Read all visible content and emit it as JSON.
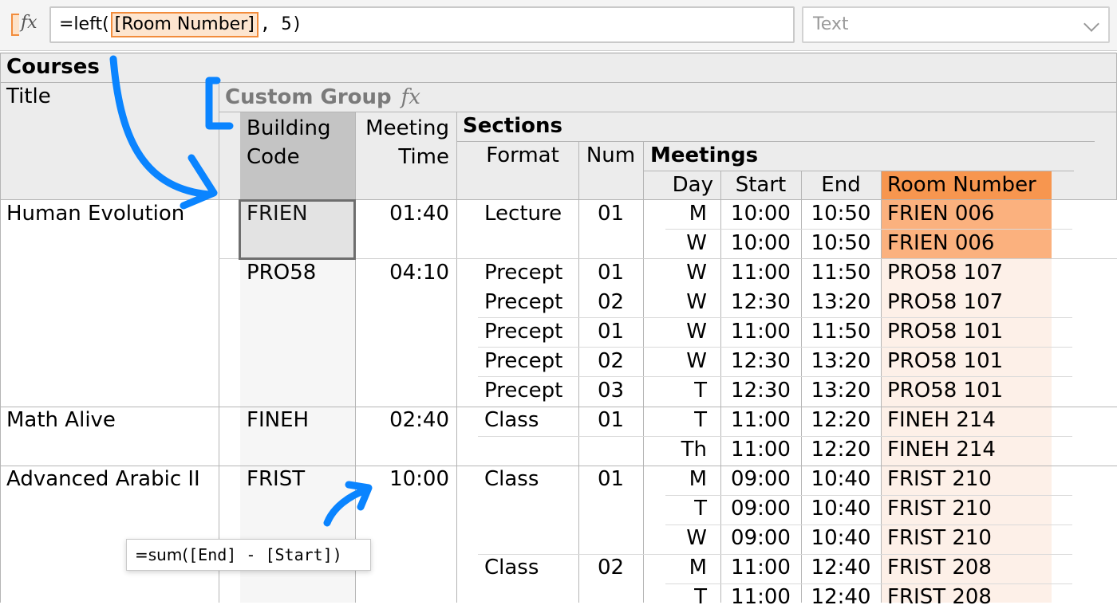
{
  "formula_bar": {
    "func": "=left(",
    "token": "[Room Number]",
    "rest": ", 5)",
    "type_value": "Text"
  },
  "headers": {
    "courses": "Courses",
    "title": "Title",
    "custom_group": "Custom Group",
    "custom_group_fx": "fx",
    "building_code_1": "Building",
    "building_code_2": "Code",
    "meeting_time_1": "Meeting",
    "meeting_time_2": "Time",
    "sections": "Sections",
    "format": "Format",
    "num": "Num",
    "meetings": "Meetings",
    "day": "Day",
    "start": "Start",
    "end": "End",
    "room_number": "Room Number"
  },
  "courses": [
    {
      "title": "Human Evolution",
      "building": "FRIEN",
      "time": "01:40"
    },
    {
      "title": "",
      "building": "PRO58",
      "time": "04:10"
    },
    {
      "title": "Math Alive",
      "building": "FINEH",
      "time": "02:40"
    },
    {
      "title": "Advanced Arabic II",
      "building": "FRIST",
      "time": "10:00"
    }
  ],
  "sections": [
    {
      "format": "Lecture",
      "num": "01"
    },
    {
      "format": "Precept",
      "num": "01"
    },
    {
      "format": "Precept",
      "num": "02"
    },
    {
      "format": "Precept",
      "num": "01"
    },
    {
      "format": "Precept",
      "num": "02"
    },
    {
      "format": "Precept",
      "num": "03"
    },
    {
      "format": "Class",
      "num": "01"
    },
    {
      "format": "Class",
      "num": "01"
    },
    {
      "format": "Class",
      "num": "02"
    }
  ],
  "meetings": [
    {
      "day": "M",
      "start": "10:00",
      "end": "10:50",
      "room": "FRIEN 006"
    },
    {
      "day": "W",
      "start": "10:00",
      "end": "10:50",
      "room": "FRIEN 006"
    },
    {
      "day": "W",
      "start": "11:00",
      "end": "11:50",
      "room": "PRO58 107"
    },
    {
      "day": "W",
      "start": "12:30",
      "end": "13:20",
      "room": "PRO58 107"
    },
    {
      "day": "W",
      "start": "11:00",
      "end": "11:50",
      "room": "PRO58 101"
    },
    {
      "day": "W",
      "start": "12:30",
      "end": "13:20",
      "room": "PRO58 101"
    },
    {
      "day": "T",
      "start": "12:30",
      "end": "13:20",
      "room": "PRO58 101"
    },
    {
      "day": "T",
      "start": "11:00",
      "end": "12:20",
      "room": "FINEH 214"
    },
    {
      "day": "Th",
      "start": "11:00",
      "end": "12:20",
      "room": "FINEH 214"
    },
    {
      "day": "M",
      "start": "09:00",
      "end": "10:40",
      "room": "FRIST 210"
    },
    {
      "day": "T",
      "start": "09:00",
      "end": "10:40",
      "room": "FRIST 210"
    },
    {
      "day": "W",
      "start": "09:00",
      "end": "10:40",
      "room": "FRIST 210"
    },
    {
      "day": "M",
      "start": "11:00",
      "end": "12:40",
      "room": "FRIST 208"
    },
    {
      "day": "T",
      "start": "11:00",
      "end": "12:40",
      "room": "FRIST 208"
    }
  ],
  "tooltip": {
    "func": "=sum(",
    "rest": "[End] - [Start])"
  },
  "colors": {
    "accent_orange": "#f7964f",
    "room_selected": "#fbb17e",
    "room_tint": "#fdf0e8",
    "annotation_blue": "#0a84ff",
    "header_gray": "#ececec"
  }
}
